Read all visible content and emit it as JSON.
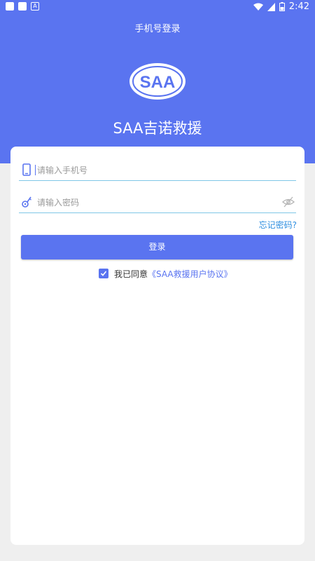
{
  "status_bar": {
    "time": "2:42"
  },
  "header": {
    "title": "手机号登录",
    "app_name": "SAA吉诺救援"
  },
  "logo": {
    "text": "SAA"
  },
  "form": {
    "phone_placeholder": "请输入手机号",
    "phone_value": "",
    "password_placeholder": "请输入密码",
    "password_value": "",
    "forgot_label": "忘记密码?",
    "login_label": "登录"
  },
  "agreement": {
    "checked": true,
    "prefix": "我已同意",
    "link_text": "《SAA救援用户协议》"
  },
  "colors": {
    "primary": "#5a74f0",
    "link": "#2f8fe0",
    "underline": "#7fc7e6"
  }
}
